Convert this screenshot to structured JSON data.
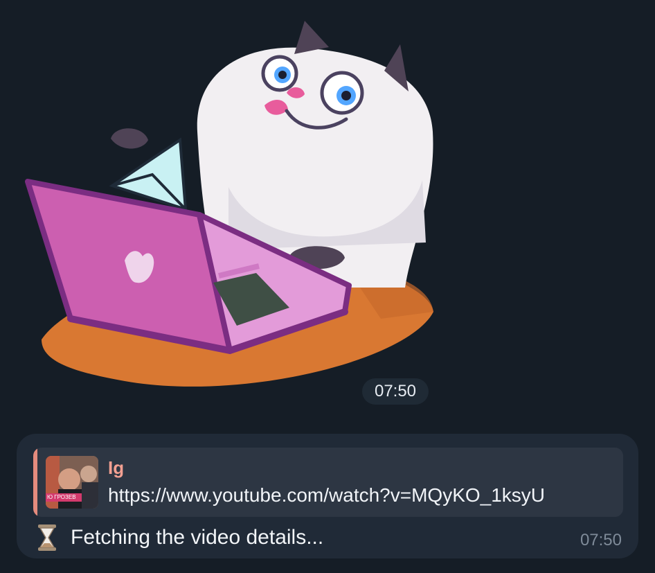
{
  "sticker": {
    "icon": "cat-with-laptop-sticker"
  },
  "sticker_time": "07:50",
  "message": {
    "reply": {
      "sender": "Ig",
      "text": "https://www.youtube.com/watch?v=MQyKO_1ksyU",
      "thumbnail_label": "Ю ГРОЗЕВ"
    },
    "status_icon": "hourglass-icon",
    "status_text": "Fetching the video details...",
    "time": "07:50"
  },
  "colors": {
    "background": "#151d26",
    "bubble": "#202a37",
    "quote": "#2d3643",
    "accent": "#e48b7d",
    "time_text": "#7f8b99"
  }
}
